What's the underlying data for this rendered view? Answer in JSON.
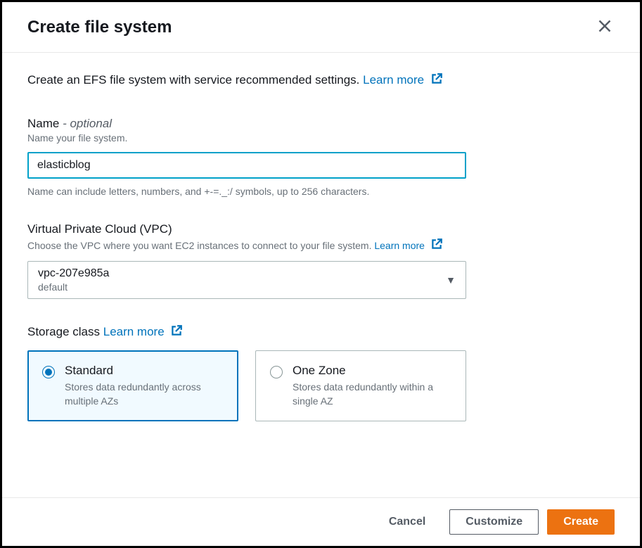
{
  "header": {
    "title": "Create file system"
  },
  "intro": {
    "text": "Create an EFS file system with service recommended settings.",
    "learn_more": "Learn more"
  },
  "name_field": {
    "label_text": "Name",
    "optional_suffix": " - optional",
    "hint": "Name your file system.",
    "value": "elasticblog",
    "constraint": "Name can include letters, numbers, and +-=._:/ symbols, up to 256 characters."
  },
  "vpc_field": {
    "label": "Virtual Private Cloud (VPC)",
    "hint": "Choose the VPC where you want EC2 instances to connect to your file system.",
    "learn_more": "Learn more",
    "selected_value": "vpc-207e985a",
    "selected_sub": "default"
  },
  "storage_field": {
    "label": "Storage class",
    "learn_more": "Learn more",
    "options": [
      {
        "title": "Standard",
        "desc": "Stores data redundantly across multiple AZs",
        "selected": true
      },
      {
        "title": "One Zone",
        "desc": "Stores data redundantly within a single AZ",
        "selected": false
      }
    ]
  },
  "footer": {
    "cancel": "Cancel",
    "customize": "Customize",
    "create": "Create"
  }
}
